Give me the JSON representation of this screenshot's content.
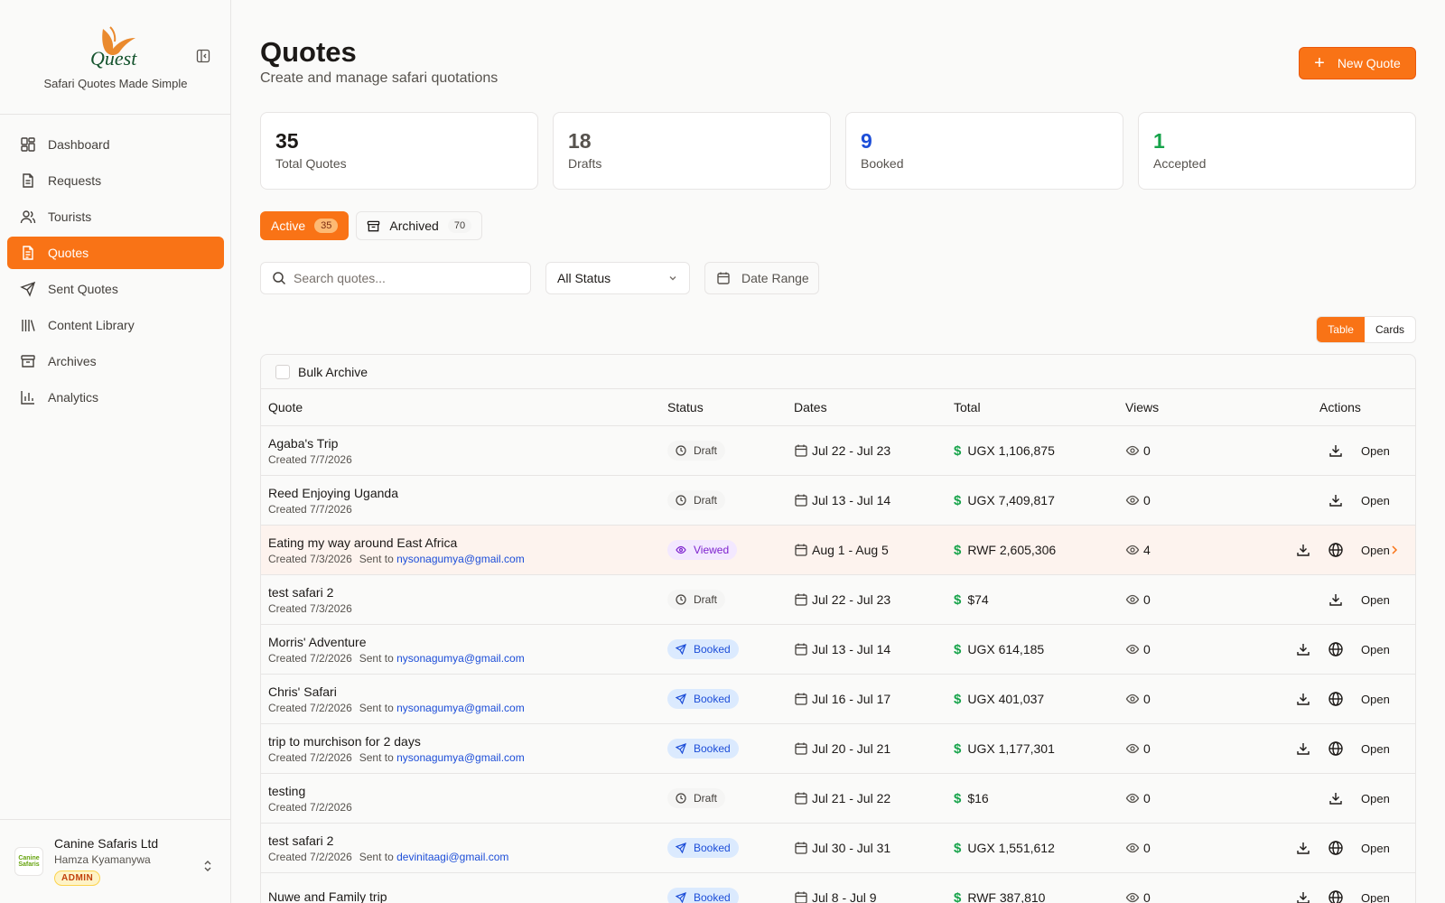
{
  "brand": {
    "logo_text": "Quest",
    "tagline": "Safari Quotes Made Simple"
  },
  "sidebar": {
    "items": [
      {
        "label": "Dashboard",
        "icon": "dashboard-icon"
      },
      {
        "label": "Requests",
        "icon": "file-icon"
      },
      {
        "label": "Tourists",
        "icon": "users-icon"
      },
      {
        "label": "Quotes",
        "icon": "file-text-icon",
        "active": true
      },
      {
        "label": "Sent Quotes",
        "icon": "send-icon"
      },
      {
        "label": "Content Library",
        "icon": "library-icon"
      },
      {
        "label": "Archives",
        "icon": "archive-icon"
      },
      {
        "label": "Analytics",
        "icon": "bar-chart-icon"
      }
    ]
  },
  "user": {
    "org_name": "Canine Safaris Ltd",
    "org_avatar_text": "Canine Safaris",
    "user_name": "Hamza Kyamanywa",
    "role": "ADMIN"
  },
  "header": {
    "title": "Quotes",
    "subtitle": "Create and manage safari quotations",
    "new_button": "New Quote"
  },
  "stats": [
    {
      "value": "35",
      "label": "Total Quotes",
      "color": "#1c1917"
    },
    {
      "value": "18",
      "label": "Drafts",
      "color": "#57534e"
    },
    {
      "value": "9",
      "label": "Booked",
      "color": "#1d4ed8"
    },
    {
      "value": "1",
      "label": "Accepted",
      "color": "#16a34a"
    }
  ],
  "tabs": {
    "active_label": "Active",
    "active_count": "35",
    "archived_label": "Archived",
    "archived_count": "70"
  },
  "filters": {
    "search_placeholder": "Search quotes...",
    "status_value": "All Status",
    "date_label": "Date Range"
  },
  "view_toggle": {
    "table": "Table",
    "cards": "Cards"
  },
  "table": {
    "bulk_label": "Bulk Archive",
    "headers": {
      "quote": "Quote",
      "status": "Status",
      "dates": "Dates",
      "total": "Total",
      "views": "Views",
      "actions": "Actions"
    },
    "sent_prefix": "Sent to",
    "open_label": "Open",
    "rows": [
      {
        "title": "Agaba's Trip",
        "created": "Created 7/7/2026",
        "sent_to": "",
        "status": "Draft",
        "dates": "Jul 22 - Jul 23",
        "total": "UGX 1,106,875",
        "views": "0",
        "web": false,
        "highlight": false
      },
      {
        "title": "Reed Enjoying Uganda",
        "created": "Created 7/7/2026",
        "sent_to": "",
        "status": "Draft",
        "dates": "Jul 13 - Jul 14",
        "total": "UGX 7,409,817",
        "views": "0",
        "web": false,
        "highlight": false
      },
      {
        "title": "Eating my way around East Africa",
        "created": "Created 7/3/2026",
        "sent_to": "nysonagumya@gmail.com",
        "status": "Viewed",
        "dates": "Aug 1 - Aug 5",
        "total": "RWF 2,605,306",
        "views": "4",
        "web": true,
        "highlight": true
      },
      {
        "title": "test safari 2",
        "created": "Created 7/3/2026",
        "sent_to": "",
        "status": "Draft",
        "dates": "Jul 22 - Jul 23",
        "total": "$74",
        "views": "0",
        "web": false,
        "highlight": false
      },
      {
        "title": "Morris' Adventure",
        "created": "Created 7/2/2026",
        "sent_to": "nysonagumya@gmail.com",
        "status": "Booked",
        "dates": "Jul 13 - Jul 14",
        "total": "UGX 614,185",
        "views": "0",
        "web": true,
        "highlight": false
      },
      {
        "title": "Chris' Safari",
        "created": "Created 7/2/2026",
        "sent_to": "nysonagumya@gmail.com",
        "status": "Booked",
        "dates": "Jul 16 - Jul 17",
        "total": "UGX 401,037",
        "views": "0",
        "web": true,
        "highlight": false
      },
      {
        "title": "trip to murchison for 2 days",
        "created": "Created 7/2/2026",
        "sent_to": "nysonagumya@gmail.com",
        "status": "Booked",
        "dates": "Jul 20 - Jul 21",
        "total": "UGX 1,177,301",
        "views": "0",
        "web": true,
        "highlight": false
      },
      {
        "title": "testing",
        "created": "Created 7/2/2026",
        "sent_to": "",
        "status": "Draft",
        "dates": "Jul 21 - Jul 22",
        "total": "$16",
        "views": "0",
        "web": false,
        "highlight": false
      },
      {
        "title": "test safari 2",
        "created": "Created 7/2/2026",
        "sent_to": "devinitaagi@gmail.com",
        "status": "Booked",
        "dates": "Jul 30 - Jul 31",
        "total": "UGX 1,551,612",
        "views": "0",
        "web": true,
        "highlight": false
      },
      {
        "title": "Nuwe and Family trip",
        "created": "",
        "sent_to": "",
        "status": "Booked",
        "dates": "Jul 8 - Jul 9",
        "total": "RWF 387,810",
        "views": "0",
        "web": true,
        "highlight": false
      }
    ]
  }
}
